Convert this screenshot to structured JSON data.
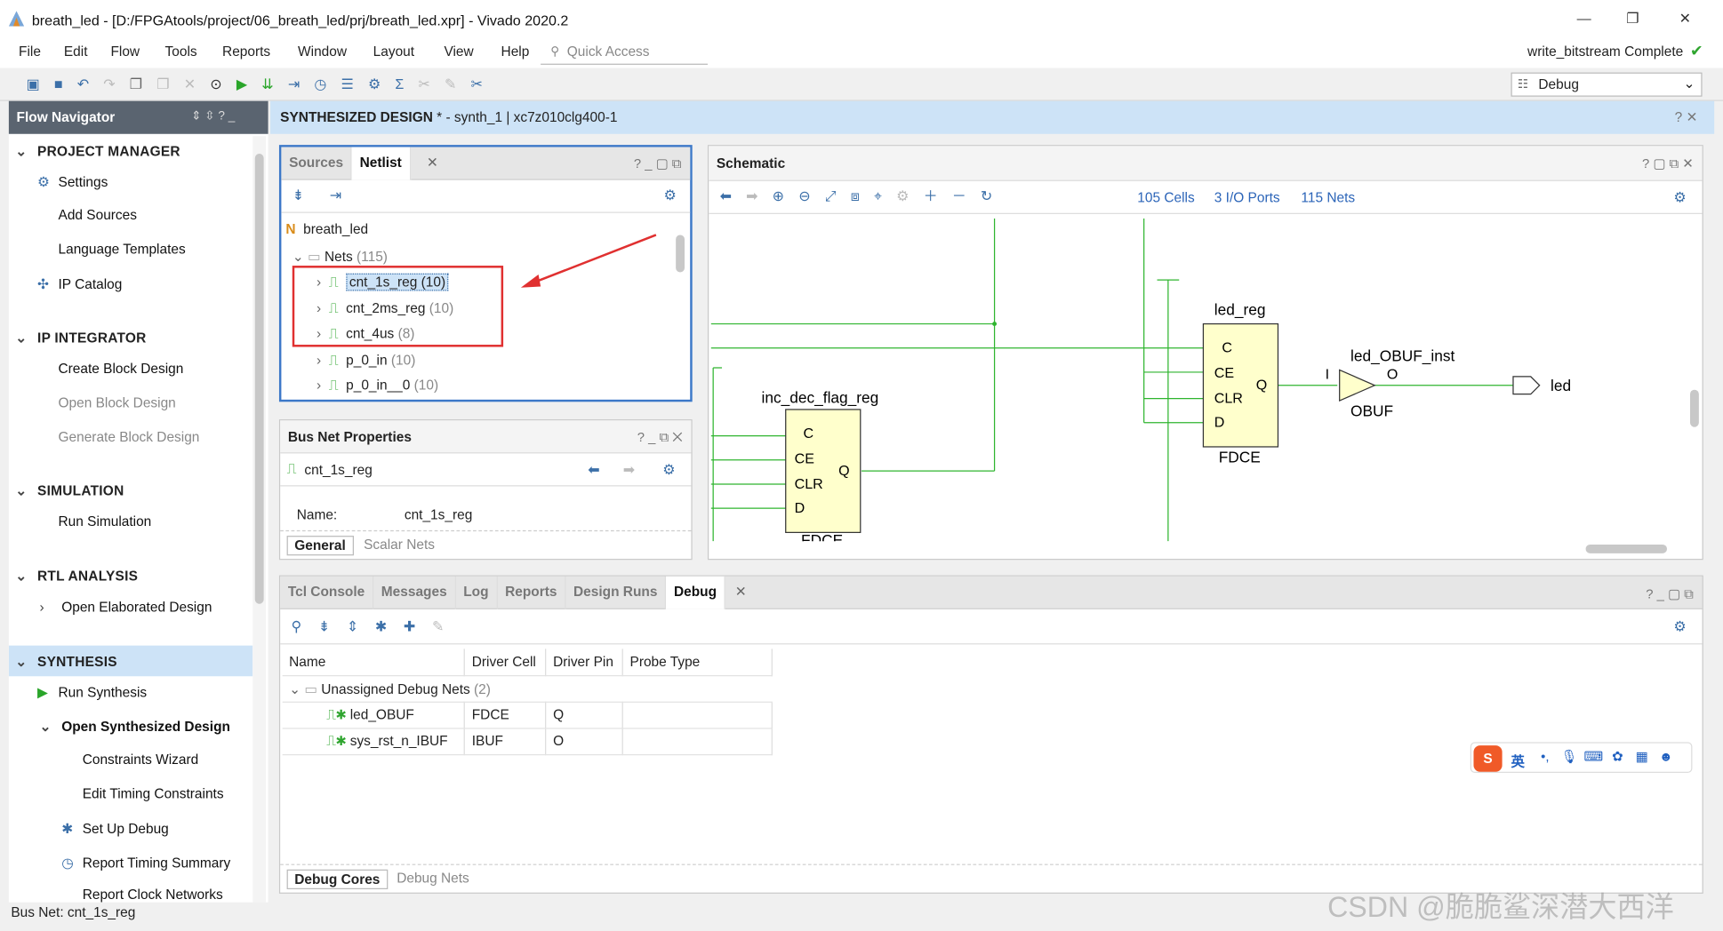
{
  "window": {
    "title": "breath_led - [D:/FPGAtools/project/06_breath_led/prj/breath_led.xpr] - Vivado 2020.2",
    "min": "—",
    "max": "❐",
    "close": "✕"
  },
  "menu": [
    "File",
    "Edit",
    "Flow",
    "Tools",
    "Reports",
    "Window",
    "Layout",
    "View",
    "Help"
  ],
  "quick_access": "Quick Access",
  "status_right": "write_bitstream Complete",
  "layout_select": "Debug",
  "flow_nav": {
    "title": "Flow Navigator",
    "sections": [
      {
        "label": "PROJECT MANAGER",
        "items": [
          "Settings",
          "Add Sources",
          "Language Templates",
          "IP Catalog"
        ]
      },
      {
        "label": "IP INTEGRATOR",
        "items": [
          "Create Block Design",
          "Open Block Design",
          "Generate Block Design"
        ]
      },
      {
        "label": "SIMULATION",
        "items": [
          "Run Simulation"
        ]
      },
      {
        "label": "RTL ANALYSIS",
        "items": [
          "Open Elaborated Design"
        ]
      },
      {
        "label": "SYNTHESIS",
        "items": [
          "Run Synthesis",
          "Open Synthesized Design",
          "Constraints Wizard",
          "Edit Timing Constraints",
          "Set Up Debug",
          "Report Timing Summary",
          "Report Clock Networks"
        ]
      }
    ]
  },
  "design_header": {
    "title": "SYNTHESIZED DESIGN",
    "detail": " * - synth_1 | xc7z010clg400-1"
  },
  "sources_panel": {
    "tabs": [
      "Sources",
      "Netlist"
    ],
    "root": "breath_led",
    "nets": {
      "label": "Nets",
      "count": "(115)"
    },
    "items": [
      {
        "name": "cnt_1s_reg",
        "count": "(10)"
      },
      {
        "name": "cnt_2ms_reg",
        "count": "(10)"
      },
      {
        "name": "cnt_4us",
        "count": "(8)"
      },
      {
        "name": "p_0_in",
        "count": "(10)"
      },
      {
        "name": "p_0_in__0",
        "count": "(10)"
      }
    ]
  },
  "bus_props": {
    "title": "Bus Net Properties",
    "net": "cnt_1s_reg",
    "name_label": "Name:",
    "name_value": "cnt_1s_reg",
    "tabs": [
      "General",
      "Scalar Nets"
    ]
  },
  "schematic": {
    "title": "Schematic",
    "cells": "105 Cells",
    "ports": "3 I/O Ports",
    "nets": "115 Nets",
    "led_reg": {
      "name": "led_reg",
      "pins": [
        "C",
        "CE",
        "CLR",
        "D"
      ],
      "out": "Q",
      "type": "FDCE"
    },
    "inc_reg": {
      "name": "inc_dec_flag_reg",
      "pins": [
        "C",
        "CE",
        "CLR",
        "D"
      ],
      "out": "Q",
      "type": "FDCE"
    },
    "obuf": {
      "name": "led_OBUF_inst",
      "in": "I",
      "out": "O",
      "type": "OBUF"
    },
    "port": "led"
  },
  "bottom_panel": {
    "tabs": [
      "Tcl Console",
      "Messages",
      "Log",
      "Reports",
      "Design Runs",
      "Debug"
    ],
    "columns": [
      "Name",
      "Driver Cell",
      "Driver Pin",
      "Probe Type"
    ],
    "group": {
      "label": "Unassigned Debug Nets",
      "count": "(2)"
    },
    "rows": [
      {
        "name": "led_OBUF",
        "cell": "FDCE",
        "pin": "Q",
        "probe": ""
      },
      {
        "name": "sys_rst_n_IBUF",
        "cell": "IBUF",
        "pin": "O",
        "probe": ""
      }
    ],
    "footer_tabs": [
      "Debug Cores",
      "Debug Nets"
    ]
  },
  "ime": {
    "lang": "英"
  },
  "statusbar": "Bus Net: cnt_1s_reg",
  "watermark": "CSDN @脆脆鲨深潜大西洋",
  "colors": {
    "accent": "#3b6fa8",
    "header_bg": "#cde3f7",
    "active_border": "#3c78c8",
    "highlight": "#e03030",
    "net": "#2fb52f",
    "cell_fill": "#ffffcc"
  }
}
